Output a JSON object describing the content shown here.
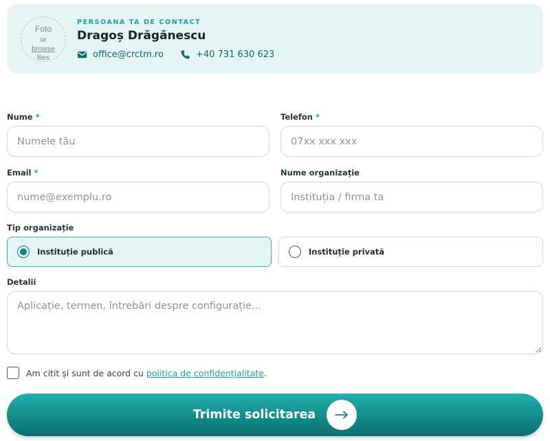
{
  "contact": {
    "photo": {
      "line1": "Foto",
      "line2": "or",
      "line3": "browse",
      "line4": "files"
    },
    "eyebrow": "PERSOANA TA DE CONTACT",
    "name": "Dragoș Drăgănescu",
    "email": "office@crctm.ro",
    "phone": "+40 731 630 623",
    "email_icon": "mail-icon",
    "phone_icon": "phone-icon"
  },
  "form": {
    "required_marker": "*",
    "name": {
      "label": "Nume",
      "placeholder": "Numele tău",
      "value": ""
    },
    "phone": {
      "label": "Telefon",
      "placeholder": "07xx xxx xxx",
      "value": ""
    },
    "email": {
      "label": "Email",
      "placeholder": "nume@exemplu.ro",
      "value": ""
    },
    "organization": {
      "label": "Nume organizație",
      "placeholder": "Instituția / firma ta",
      "value": ""
    },
    "org_type": {
      "label": "Tip organizație",
      "options": [
        {
          "label": "Instituție publică",
          "selected": true
        },
        {
          "label": "Instituție privată",
          "selected": false
        }
      ]
    },
    "details": {
      "label": "Detalii",
      "placeholder": "Aplicație, termen, întrebări despre configurație...",
      "value": ""
    },
    "consent": {
      "checked": false,
      "text_before": "Am citit și sunt de acord cu ",
      "link": "politica de confidențialitate",
      "text_after": "."
    },
    "submit_label": "Trimite solicitarea",
    "submit_icon": "arrow-right-icon"
  },
  "colors": {
    "accent": "#1aa3a3",
    "accent_dark": "#167f80",
    "card_bg": "#e4f5f4"
  }
}
